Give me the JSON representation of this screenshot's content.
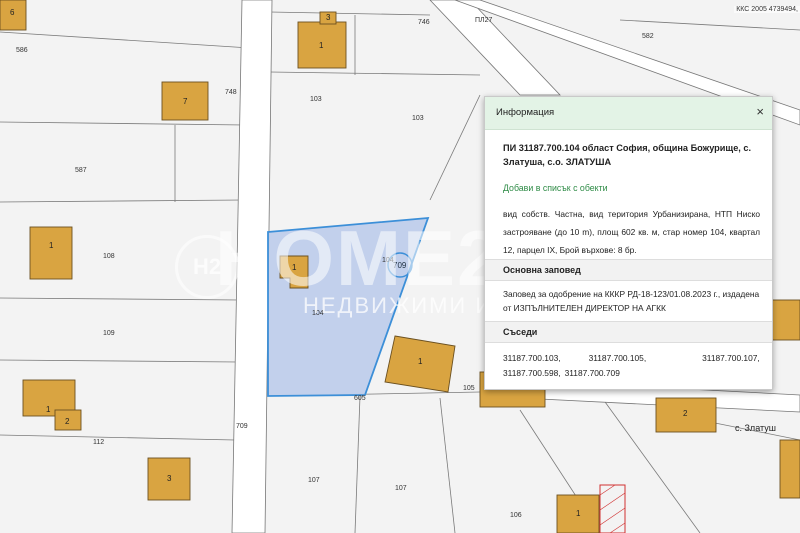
{
  "map": {
    "coords_label": "ККС 2005 4739494,",
    "locality_label": "с. Златуш",
    "colors": {
      "background": "#f3f3f3",
      "road": "#ffffff",
      "building": "#d9a441",
      "selected_parcel": "#b9c9ea",
      "selected_outline": "#3c8fd8"
    },
    "parcel_labels": [
      "586",
      "587",
      "108",
      "109",
      "112",
      "748",
      "103",
      "103",
      "104",
      "104",
      "105",
      "106",
      "107",
      "107",
      "709",
      "746",
      "582",
      "605",
      "2",
      "2",
      "3",
      "3",
      "1",
      "7",
      "6",
      "?"
    ],
    "building_labels": [
      "1",
      "1",
      "1",
      "1",
      "2",
      "2",
      "3",
      "3",
      "3",
      "1",
      "7",
      "6",
      "1",
      "1"
    ],
    "selected_parcel_label": "709",
    "watermark": {
      "brand": "HOME2",
      "subtitle": "НЕДВИЖИМИ ИМОТИ",
      "logo_text": "H2"
    }
  },
  "panel": {
    "header_title": "Информация",
    "close_label": "×",
    "title": "ПИ 31187.700.104 област София, община Божурище, с. Златуша, с.о. ЗЛАТУША",
    "add_link": "Добави в списък с обекти",
    "description": "вид собств. Частна, вид територия Урбанизирана, НТП Ниско застрояване (до 10 m), площ 602 кв. м, стар номер 104, квартал 12, парцел IX, Брой върхове: 8 бр.",
    "order_heading": "Основна заповед",
    "order_text": "Заповед за одобрение на КККР РД-18-123/01.08.2023 г., издадена от ИЗПЪЛНИТЕЛЕН ДИРЕКТОР НА АГКК",
    "neighbors_heading": "Съседи",
    "neighbors": [
      "31187.700.103,",
      "31187.700.105,",
      "31187.700.107,",
      "31187.700.598,",
      "31187.700.709"
    ]
  }
}
